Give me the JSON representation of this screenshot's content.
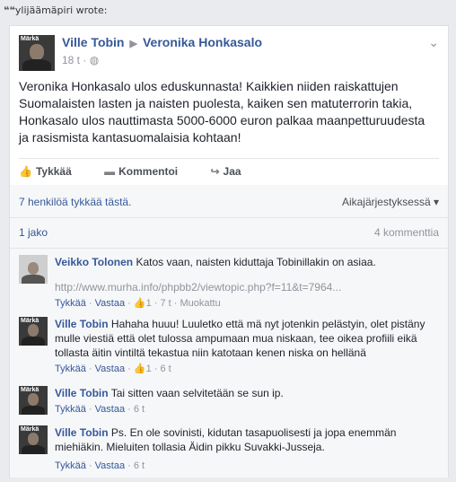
{
  "quote": {
    "author": "ylijäämäpiri",
    "suffix": "wrote:"
  },
  "post": {
    "author": "Ville Tobin",
    "target": "Veronika Honkasalo",
    "time": "18 t",
    "avatar_tag": "Märkä",
    "text": "Veronika Honkasalo ulos eduskunnasta! Kaikkien niiden raiskattujen Suomalaisten lasten ja naisten puolesta, kaiken sen matuterrorin takia, Honkasalo ulos nauttimasta 5000-6000 euron palkaa maanpetturuudesta ja rasismista kantasuomalaisia kohtaan!"
  },
  "actions": {
    "like": "Tykkää",
    "comment": "Kommentoi",
    "share": "Jaa"
  },
  "summary": {
    "likes": "7 henkilöä tykkää tästä.",
    "sort": "Aikajärjestyksessä"
  },
  "counts": {
    "shares": "1 jako",
    "comments": "4 kommenttia"
  },
  "comments": [
    {
      "author": "Veikko Tolonen",
      "text": "Katos vaan, naisten kiduttaja Tobinillakin on asiaa.",
      "link": "http://www.murha.info/phpbb2/viewtopic.php?f=11&t=7964...",
      "like": "Tykkää",
      "reply": "Vastaa",
      "likes": "1",
      "time": "7 t",
      "edited": "Muokattu"
    },
    {
      "author": "Ville Tobin",
      "text": "Hahaha huuu! Luuletko että mä nyt jotenkin pelästyin, olet pistäny mulle viestiä että olet tulossa ampumaan mua niskaan, tee oikea profiili eikä tollasta äitin vintiltä tekastua niin katotaan kenen niska on hellänä",
      "like": "Tykkää",
      "reply": "Vastaa",
      "likes": "1",
      "time": "6 t"
    },
    {
      "author": "Ville Tobin",
      "text": "Tai sitten vaan selvitetään se sun ip.",
      "like": "Tykkää",
      "reply": "Vastaa",
      "time": "6 t"
    },
    {
      "author": "Ville Tobin",
      "text": "Ps. En ole sovinisti, kidutan tasapuolisesti ja jopa enemmän miehiäkin. Mieluiten tollasia Äidin pikku Suvakki-Jusseja.",
      "like": "Tykkää",
      "reply": "Vastaa",
      "time": "6 t"
    }
  ]
}
